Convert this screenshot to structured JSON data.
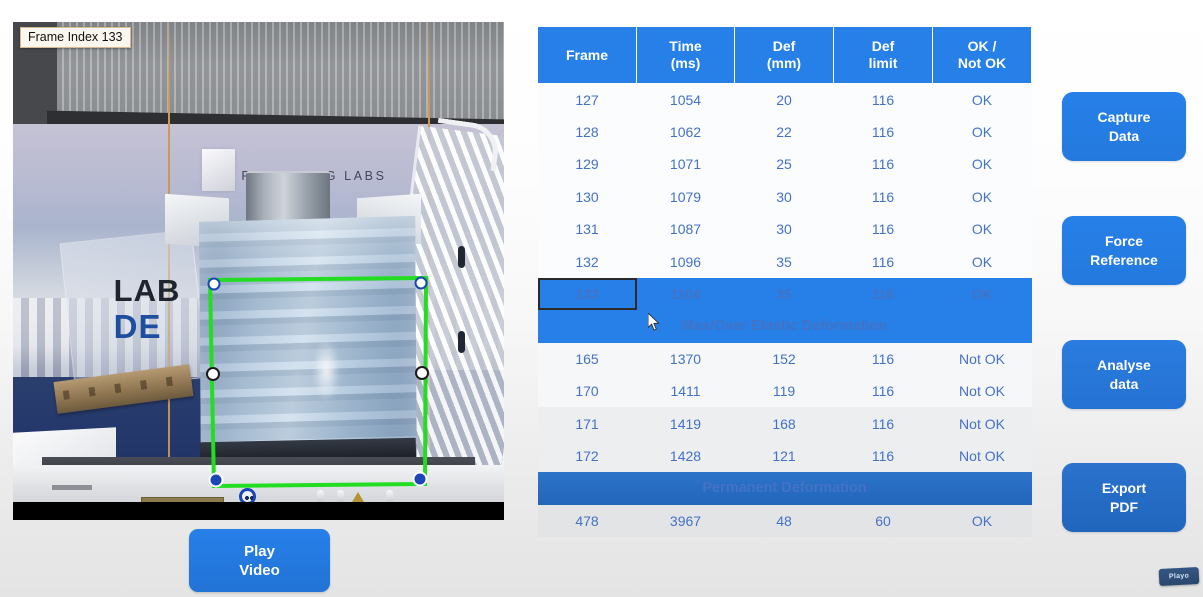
{
  "video_panel": {
    "frame_index_label": "Frame Index 133",
    "banner_logo_text": "PACKAGING LABS",
    "overlay_word_1": "LAB",
    "overlay_word_2": "DE",
    "tracking_box_color": "#22dd22",
    "marker_color": "#1b46b8"
  },
  "play_button": {
    "line1": "Play",
    "line2": "Video"
  },
  "table": {
    "headers": [
      {
        "line1": "Frame",
        "line2": ""
      },
      {
        "line1": "Time",
        "line2": "(ms)"
      },
      {
        "line1": "Def",
        "line2": "(mm)"
      },
      {
        "line1": "Def",
        "line2": "limit"
      },
      {
        "line1": "OK /",
        "line2": "Not OK"
      }
    ],
    "rows_top": [
      {
        "frame": "127",
        "time": "1054",
        "def": "20",
        "limit": "116",
        "status": "OK",
        "selected": false
      },
      {
        "frame": "128",
        "time": "1062",
        "def": "22",
        "limit": "116",
        "status": "OK",
        "selected": false
      },
      {
        "frame": "129",
        "time": "1071",
        "def": "25",
        "limit": "116",
        "status": "OK",
        "selected": false
      },
      {
        "frame": "130",
        "time": "1079",
        "def": "30",
        "limit": "116",
        "status": "OK",
        "selected": false
      },
      {
        "frame": "131",
        "time": "1087",
        "def": "30",
        "limit": "116",
        "status": "OK",
        "selected": false
      },
      {
        "frame": "132",
        "time": "1096",
        "def": "35",
        "limit": "116",
        "status": "OK",
        "selected": false
      },
      {
        "frame": "133",
        "time": "1104",
        "def": "35",
        "limit": "116",
        "status": "OK",
        "selected": true
      }
    ],
    "section_elastic": "Max/Over Elastic Deformation",
    "rows_elastic": [
      {
        "frame": "165",
        "time": "1370",
        "def": "152",
        "limit": "116",
        "status": "Not OK"
      },
      {
        "frame": "170",
        "time": "1411",
        "def": "119",
        "limit": "116",
        "status": "Not OK"
      },
      {
        "frame": "171",
        "time": "1419",
        "def": "168",
        "limit": "116",
        "status": "Not OK"
      },
      {
        "frame": "172",
        "time": "1428",
        "def": "121",
        "limit": "116",
        "status": "Not OK"
      }
    ],
    "section_permanent": "Permanent Deformation",
    "rows_permanent": [
      {
        "frame": "478",
        "time": "3967",
        "def": "48",
        "limit": "60",
        "status": "OK"
      }
    ]
  },
  "actions": [
    {
      "id": "capture-data",
      "line1": "Capture",
      "line2": "Data"
    },
    {
      "id": "force-reference",
      "line1": "Force",
      "line2": "Reference"
    },
    {
      "id": "analyse-data",
      "line1": "Analyse",
      "line2": "data"
    },
    {
      "id": "export-pdf",
      "line1": "Export",
      "line2": "PDF"
    }
  ],
  "watermark": {
    "text": "Playo"
  },
  "theme": {
    "accent_blue": "#2680e8",
    "table_text_blue": "#4472c4",
    "section_permanent_blue": "#2166bb",
    "page_bg_top": "#ffffff",
    "page_bg_bottom": "#e4e4e4"
  }
}
